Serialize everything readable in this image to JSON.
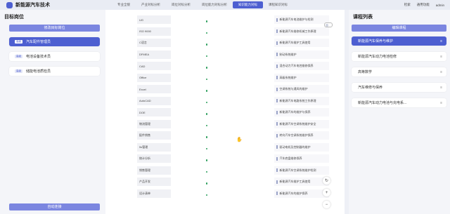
{
  "app": {
    "title": "新能源汽车技术"
  },
  "nav": {
    "tabs": [
      "专业全貌",
      "产业对标分析",
      "岗位对标分析",
      "岗位能力对标分析",
      "知识能力对标",
      "课程知识对标"
    ],
    "active_index": 4
  },
  "topbar": {
    "search_label": "检索",
    "user_center": "通用功能",
    "user": "admin"
  },
  "left": {
    "title": "目标岗位",
    "edit_button": "修改目标岗位",
    "tag": "高级",
    "posts": [
      {
        "label": "汽车配件管理员",
        "active": true
      },
      {
        "label": "电池设备技术员",
        "active": false
      },
      {
        "label": "储能电池质检员",
        "active": false
      }
    ],
    "auto_button": "自动连接"
  },
  "middle": {
    "skills": [
      "UG",
      "ISO 9000",
      "C语言",
      "DFMEA",
      "CAD",
      "Office",
      "Excel",
      "AutoCAD",
      "DOE",
      "物流管理",
      "配件销售",
      "5s管理",
      "统计分析",
      "销售管理",
      "产品开发",
      "设计清单"
    ],
    "courses": [
      "新能源汽车电池维护与检测",
      "新能源汽车维修机械工作原理",
      "新能源汽车维护工具使用",
      "制动系统维护",
      "混合动力汽车电控维修保养",
      "高级系统维护",
      "空调系统与通风的维护",
      "新能源汽车电路系统工作原理",
      "新能源汽车的维护与保养",
      "新能源汽车空调系统维护安全",
      "转向汽车空调系统维护保养",
      "驱动电机及控制器的维护",
      "汽车底盘维修保养",
      "新能源汽车空调系统维护检测",
      "新能源汽车维护工具使用",
      "新能源汽车的维护保养"
    ],
    "float_icons": [
      "refresh-icon",
      "plus-icon",
      "minus-icon"
    ]
  },
  "right": {
    "title": "课程列表",
    "edit_button": "编辑课程",
    "courses": [
      {
        "label": "新能源汽车保养与维护",
        "active": true
      },
      {
        "label": "新能源汽车动力电池检修",
        "active": false
      },
      {
        "label": "高等数学",
        "active": false
      },
      {
        "label": "汽车维修与保养",
        "active": false
      },
      {
        "label": "新能源汽车动力电池与充电系...",
        "active": false
      }
    ]
  }
}
